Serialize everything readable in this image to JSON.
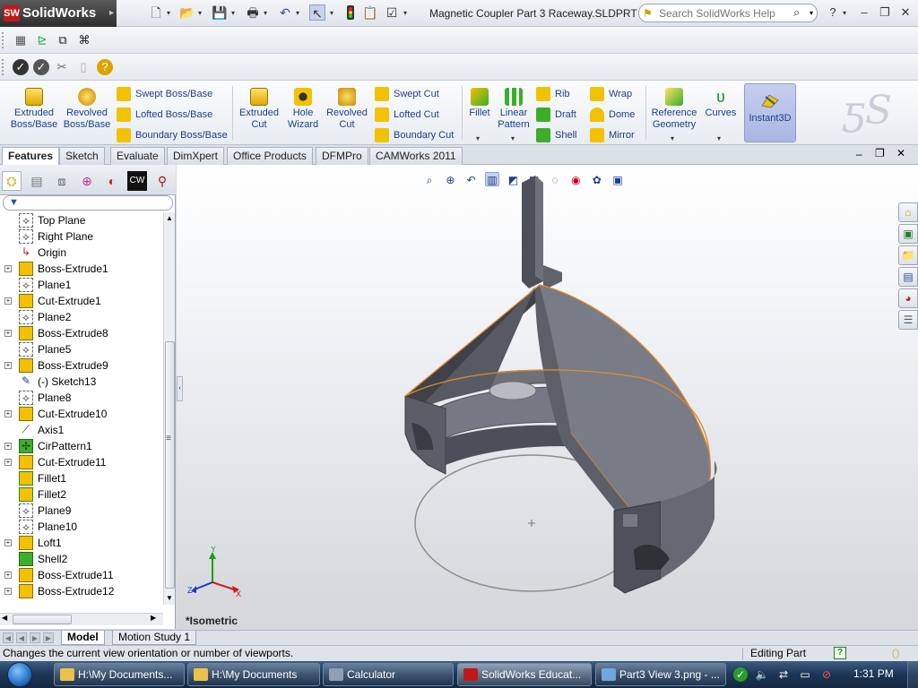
{
  "app": {
    "name": "SolidWorks",
    "document_title": "Magnetic Coupler Part 3 Raceway.SLDPRT *",
    "help_search_placeholder": "Search SolidWorks Help",
    "help_q": "?"
  },
  "command_manager": {
    "extruded_boss": "Extruded Boss/Base",
    "revolved_boss": "Revolved Boss/Base",
    "swept_boss": "Swept Boss/Base",
    "lofted_boss": "Lofted Boss/Base",
    "boundary_boss": "Boundary Boss/Base",
    "extruded_cut": "Extruded Cut",
    "hole_wizard": "Hole Wizard",
    "revolved_cut": "Revolved Cut",
    "swept_cut": "Swept Cut",
    "lofted_cut": "Lofted Cut",
    "boundary_cut": "Boundary Cut",
    "fillet": "Fillet",
    "linear_pattern": "Linear Pattern",
    "rib": "Rib",
    "draft": "Draft",
    "shell": "Shell",
    "wrap": "Wrap",
    "dome": "Dome",
    "mirror": "Mirror",
    "reference_geometry": "Reference Geometry",
    "curves": "Curves",
    "instant3d": "Instant3D"
  },
  "tabs": [
    "Features",
    "Sketch",
    "Evaluate",
    "DimXpert",
    "Office Products",
    "DFMPro",
    "CAMWorks 2011"
  ],
  "tree": [
    {
      "label": "Top Plane",
      "icon": "plane",
      "expandable": false
    },
    {
      "label": "Right Plane",
      "icon": "plane",
      "expandable": false
    },
    {
      "label": "Origin",
      "icon": "origin",
      "expandable": false
    },
    {
      "label": "Boss-Extrude1",
      "icon": "boss",
      "expandable": true
    },
    {
      "label": "Plane1",
      "icon": "plane",
      "expandable": false
    },
    {
      "label": "Cut-Extrude1",
      "icon": "cut",
      "expandable": true
    },
    {
      "label": "Plane2",
      "icon": "plane",
      "expandable": false
    },
    {
      "label": "Boss-Extrude8",
      "icon": "boss",
      "expandable": true
    },
    {
      "label": "Plane5",
      "icon": "plane",
      "expandable": false
    },
    {
      "label": "Boss-Extrude9",
      "icon": "boss",
      "expandable": true
    },
    {
      "label": "(-) Sketch13",
      "icon": "sketch",
      "expandable": false
    },
    {
      "label": "Plane8",
      "icon": "plane",
      "expandable": false
    },
    {
      "label": "Cut-Extrude10",
      "icon": "cut",
      "expandable": true
    },
    {
      "label": "Axis1",
      "icon": "axis",
      "expandable": false
    },
    {
      "label": "CirPattern1",
      "icon": "pattern",
      "expandable": true
    },
    {
      "label": "Cut-Extrude11",
      "icon": "cut",
      "expandable": true
    },
    {
      "label": "Fillet1",
      "icon": "fillet",
      "expandable": false
    },
    {
      "label": "Fillet2",
      "icon": "fillet",
      "expandable": false
    },
    {
      "label": "Plane9",
      "icon": "plane",
      "expandable": false
    },
    {
      "label": "Plane10",
      "icon": "plane",
      "expandable": false
    },
    {
      "label": "Loft1",
      "icon": "loft",
      "expandable": true
    },
    {
      "label": "Shell2",
      "icon": "shell",
      "expandable": false
    },
    {
      "label": "Boss-Extrude11",
      "icon": "boss",
      "expandable": true
    },
    {
      "label": "Boss-Extrude12",
      "icon": "boss",
      "expandable": true
    }
  ],
  "viewport": {
    "view_name": "*Isometric",
    "triad": {
      "x": "X",
      "y": "Y",
      "z": "Z"
    }
  },
  "bottom_tabs": [
    "Model",
    "Motion Study 1"
  ],
  "status": {
    "message": "Changes the current view orientation or number of viewports.",
    "mode": "Editing Part"
  },
  "taskbar": {
    "items": [
      {
        "label": "H:\\My Documents...",
        "icon": "folder"
      },
      {
        "label": "H:\\My Documents",
        "icon": "folder"
      },
      {
        "label": "Calculator",
        "icon": "calculator"
      },
      {
        "label": "SolidWorks Educat...",
        "icon": "solidworks",
        "active": true
      },
      {
        "label": "Part3 View 3.png - ...",
        "icon": "paint"
      }
    ],
    "clock": "1:31 PM"
  },
  "colors": {
    "accent": "#1a3f8b",
    "model_face": "#5d5f68",
    "model_edge": "#e08a2c",
    "brand_red": "#c01818"
  }
}
